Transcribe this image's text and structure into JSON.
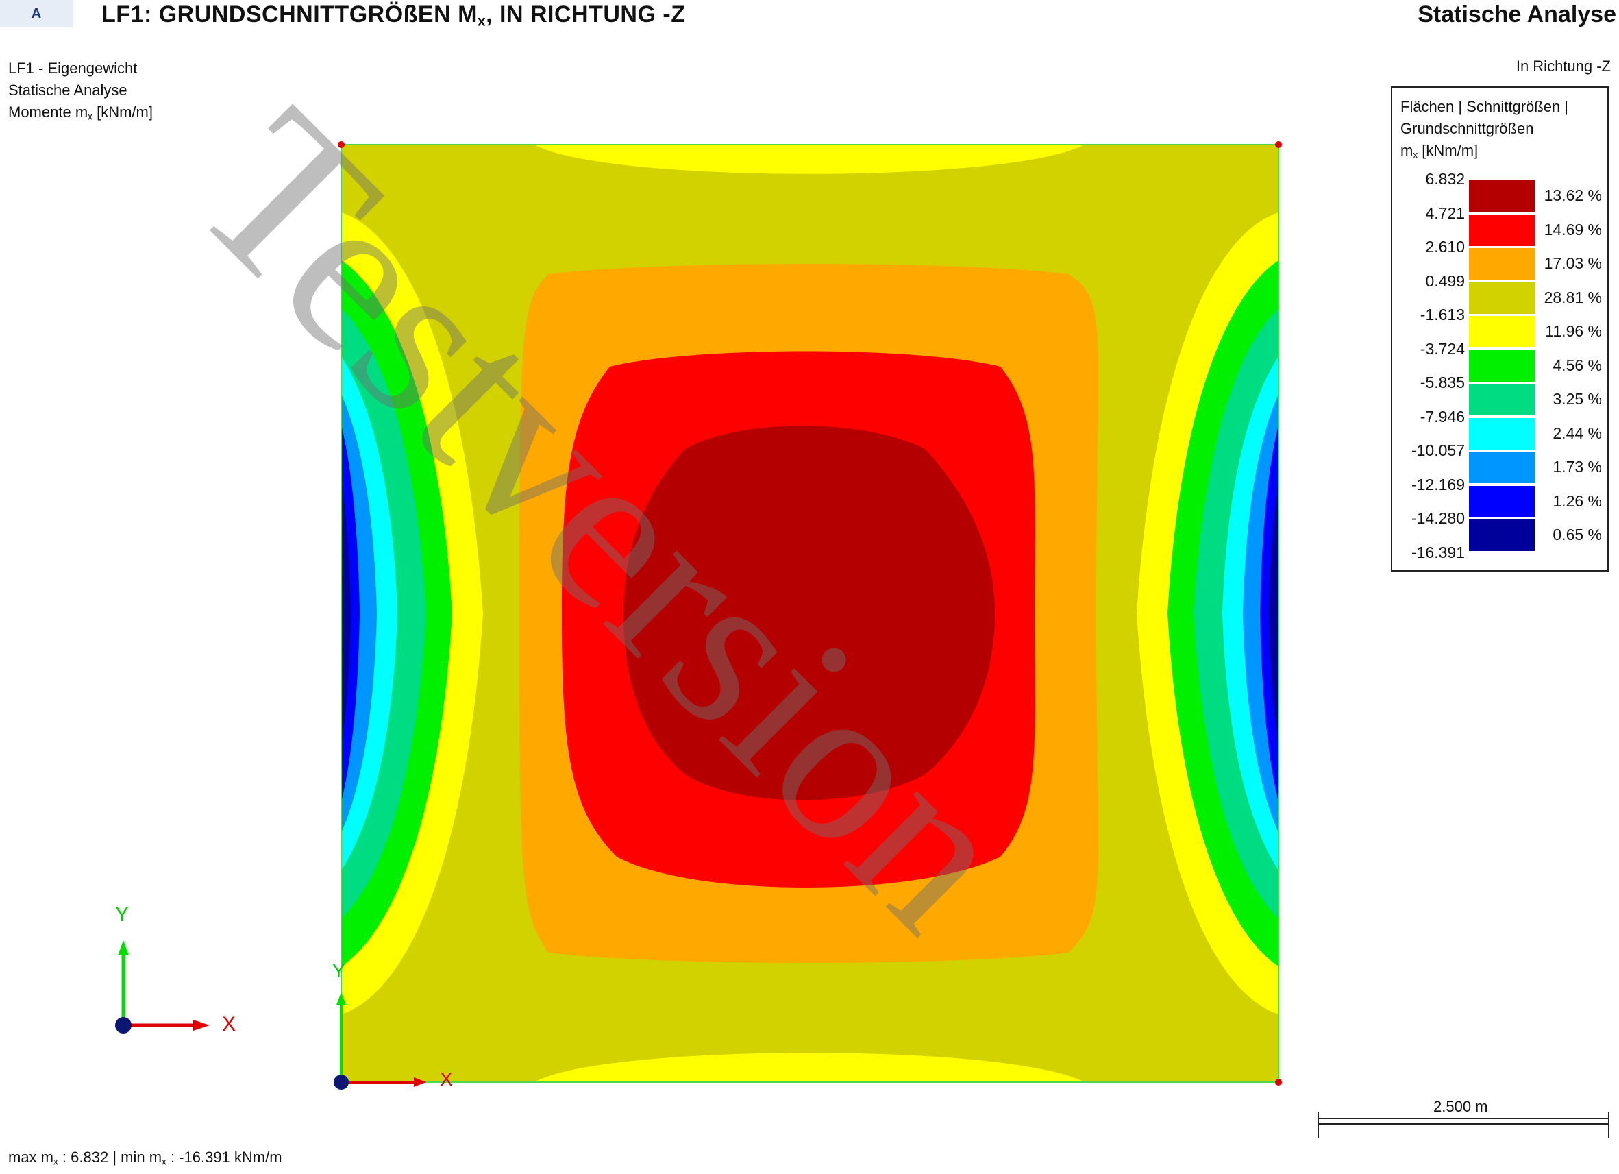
{
  "header": {
    "tag": "A",
    "title_main": "LF1: GRUNDSCHNITTGRÖßEN M",
    "title_sub": "x",
    "title_rest": ", IN RICHTUNG -Z",
    "right_title": "Statische Analyse"
  },
  "info": {
    "load_case": "LF1 - Eigengewicht",
    "analysis": "Statische Analyse",
    "moments_prefix": "Momente m",
    "moments_sub": "x",
    "moments_unit": " [kNm/m]"
  },
  "direction_label": "In Richtung -Z",
  "legend": {
    "title_line1": "Flächen | Schnittgrößen |",
    "title_line2": "Grundschnittgrößen",
    "title_var": "m",
    "title_var_sub": "x",
    "title_unit": " [kNm/m]",
    "bounds": [
      "6.832",
      "4.721",
      "2.610",
      "0.499",
      "-1.613",
      "-3.724",
      "-5.835",
      "-7.946",
      "-10.057",
      "-12.169",
      "-14.280",
      "-16.391"
    ],
    "bands": [
      {
        "color": "#b40000",
        "percent": "13.62 %"
      },
      {
        "color": "#ff0000",
        "percent": "14.69 %"
      },
      {
        "color": "#ffa800",
        "percent": "17.03 %"
      },
      {
        "color": "#d2d200",
        "percent": "28.81 %"
      },
      {
        "color": "#ffff00",
        "percent": "11.96 %"
      },
      {
        "color": "#00f000",
        "percent": "4.56 %"
      },
      {
        "color": "#00dc82",
        "percent": "3.25 %"
      },
      {
        "color": "#00ffff",
        "percent": "2.44 %"
      },
      {
        "color": "#0096ff",
        "percent": "1.73 %"
      },
      {
        "color": "#0000ff",
        "percent": "1.26 %"
      },
      {
        "color": "#00009b",
        "percent": "0.65 %"
      }
    ]
  },
  "axes": {
    "x_label": "X",
    "y_label": "Y"
  },
  "scale_bar": {
    "label": "2.500 m"
  },
  "footer": {
    "max_prefix": "max m",
    "max_sub": "x",
    "max_value": " : 6.832 | min m",
    "min_sub": "x",
    "min_value": " : -16.391 kNm/m"
  },
  "watermark": "Testversion"
}
